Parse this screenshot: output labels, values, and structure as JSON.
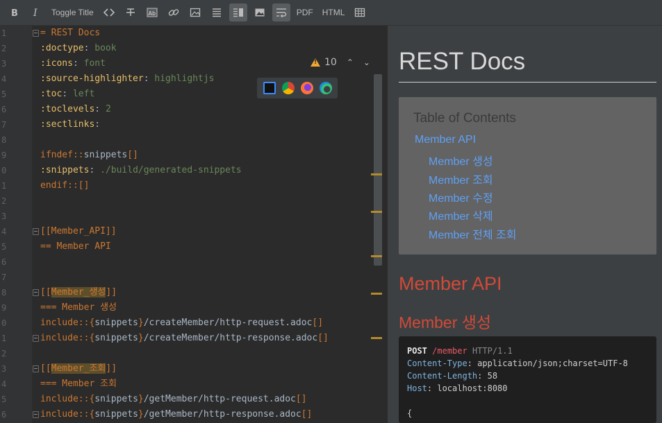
{
  "toolbar": {
    "toggle_title": "Toggle Title",
    "pdf": "PDF",
    "html": "HTML"
  },
  "editor": {
    "warnings_count": "10",
    "lines": [
      {
        "n": "1",
        "fold": true,
        "parts": [
          {
            "c": "c-orange",
            "t": "= REST Docs"
          }
        ]
      },
      {
        "n": "2",
        "parts": [
          {
            "c": "c-attr",
            "t": ":doctype"
          },
          {
            "c": "c-plain",
            "t": ": "
          },
          {
            "c": "c-green",
            "t": "book"
          }
        ]
      },
      {
        "n": "3",
        "parts": [
          {
            "c": "c-attr",
            "t": ":icons"
          },
          {
            "c": "c-plain",
            "t": ": "
          },
          {
            "c": "c-green",
            "t": "font"
          }
        ]
      },
      {
        "n": "4",
        "parts": [
          {
            "c": "c-attr",
            "t": ":source-highlighter"
          },
          {
            "c": "c-plain",
            "t": ": "
          },
          {
            "c": "c-green",
            "t": "highlightjs"
          }
        ]
      },
      {
        "n": "5",
        "parts": [
          {
            "c": "c-attr",
            "t": ":toc"
          },
          {
            "c": "c-plain",
            "t": ": "
          },
          {
            "c": "c-green",
            "t": "left"
          }
        ]
      },
      {
        "n": "6",
        "parts": [
          {
            "c": "c-attr",
            "t": ":toclevels"
          },
          {
            "c": "c-plain",
            "t": ": "
          },
          {
            "c": "c-green",
            "t": "2"
          }
        ]
      },
      {
        "n": "7",
        "parts": [
          {
            "c": "c-attr",
            "t": ":sectlinks"
          },
          {
            "c": "c-plain",
            "t": ":"
          }
        ]
      },
      {
        "n": "8",
        "parts": []
      },
      {
        "n": "9",
        "parts": [
          {
            "c": "c-orange",
            "t": "ifndef::"
          },
          {
            "c": "c-plain",
            "t": "snippets"
          },
          {
            "c": "c-orange",
            "t": "[]"
          }
        ]
      },
      {
        "n": "0",
        "parts": [
          {
            "c": "c-attr",
            "t": ":snippets"
          },
          {
            "c": "c-plain",
            "t": ": "
          },
          {
            "c": "c-green",
            "t": "./build/generated-snippets"
          }
        ]
      },
      {
        "n": "1",
        "parts": [
          {
            "c": "c-orange",
            "t": "endif::[]"
          }
        ]
      },
      {
        "n": "2",
        "parts": []
      },
      {
        "n": "3",
        "parts": []
      },
      {
        "n": "4",
        "fold": true,
        "parts": [
          {
            "c": "c-orange",
            "t": "[[Member_API]]"
          }
        ]
      },
      {
        "n": "5",
        "parts": [
          {
            "c": "c-orange",
            "t": "== Member API"
          }
        ]
      },
      {
        "n": "6",
        "parts": []
      },
      {
        "n": "7",
        "parts": []
      },
      {
        "n": "8",
        "fold": true,
        "parts": [
          {
            "c": "c-orange",
            "t": "[["
          },
          {
            "c": "c-orange hl",
            "t": "Member_생성"
          },
          {
            "c": "c-orange",
            "t": "]]"
          }
        ]
      },
      {
        "n": "9",
        "parts": [
          {
            "c": "c-orange",
            "t": "=== Member 생성"
          }
        ]
      },
      {
        "n": "0",
        "parts": [
          {
            "c": "c-orange",
            "t": "include::"
          },
          {
            "c": "c-orange",
            "t": "{"
          },
          {
            "c": "c-plain",
            "t": "snippets"
          },
          {
            "c": "c-orange",
            "t": "}"
          },
          {
            "c": "c-plain",
            "t": "/createMember/http-request.adoc"
          },
          {
            "c": "c-orange",
            "t": "[]"
          }
        ]
      },
      {
        "n": "1",
        "fold": true,
        "parts": [
          {
            "c": "c-orange",
            "t": "include::"
          },
          {
            "c": "c-orange",
            "t": "{"
          },
          {
            "c": "c-plain",
            "t": "snippets"
          },
          {
            "c": "c-orange",
            "t": "}"
          },
          {
            "c": "c-plain",
            "t": "/createMember/http-response.adoc"
          },
          {
            "c": "c-orange",
            "t": "[]"
          }
        ]
      },
      {
        "n": "2",
        "parts": []
      },
      {
        "n": "3",
        "fold": true,
        "parts": [
          {
            "c": "c-orange",
            "t": "[["
          },
          {
            "c": "c-orange hl",
            "t": "Member_조회"
          },
          {
            "c": "c-orange",
            "t": "]]"
          }
        ]
      },
      {
        "n": "4",
        "parts": [
          {
            "c": "c-orange",
            "t": "=== Member 조회"
          }
        ]
      },
      {
        "n": "5",
        "parts": [
          {
            "c": "c-orange",
            "t": "include::"
          },
          {
            "c": "c-orange",
            "t": "{"
          },
          {
            "c": "c-plain",
            "t": "snippets"
          },
          {
            "c": "c-orange",
            "t": "}"
          },
          {
            "c": "c-plain",
            "t": "/getMember/http-request.adoc"
          },
          {
            "c": "c-orange",
            "t": "[]"
          }
        ]
      },
      {
        "n": "6",
        "fold": true,
        "parts": [
          {
            "c": "c-orange",
            "t": "include::"
          },
          {
            "c": "c-orange",
            "t": "{"
          },
          {
            "c": "c-plain",
            "t": "snippets"
          },
          {
            "c": "c-orange",
            "t": "}"
          },
          {
            "c": "c-plain",
            "t": "/getMember/http-response.adoc"
          },
          {
            "c": "c-orange",
            "t": "[]"
          }
        ]
      }
    ]
  },
  "preview": {
    "title": "REST Docs",
    "toc_title": "Table of Contents",
    "toc": [
      {
        "label": "Member API",
        "level": 1
      },
      {
        "label": "Member 생성",
        "level": 2
      },
      {
        "label": "Member 조회",
        "level": 2
      },
      {
        "label": "Member 수정",
        "level": 2
      },
      {
        "label": "Member 삭제",
        "level": 2
      },
      {
        "label": "Member 전체 조회",
        "level": 2
      }
    ],
    "section_title": "Member API",
    "subsection_title": "Member 생성",
    "http": {
      "method": "POST",
      "path": "/member",
      "proto": "HTTP/1.1",
      "headers": [
        {
          "key": "Content-Type",
          "value": "application/json;charset=UTF-8"
        },
        {
          "key": "Content-Length",
          "value": "58"
        },
        {
          "key": "Host",
          "value": "localhost:8080"
        }
      ],
      "body_start": "{"
    }
  }
}
